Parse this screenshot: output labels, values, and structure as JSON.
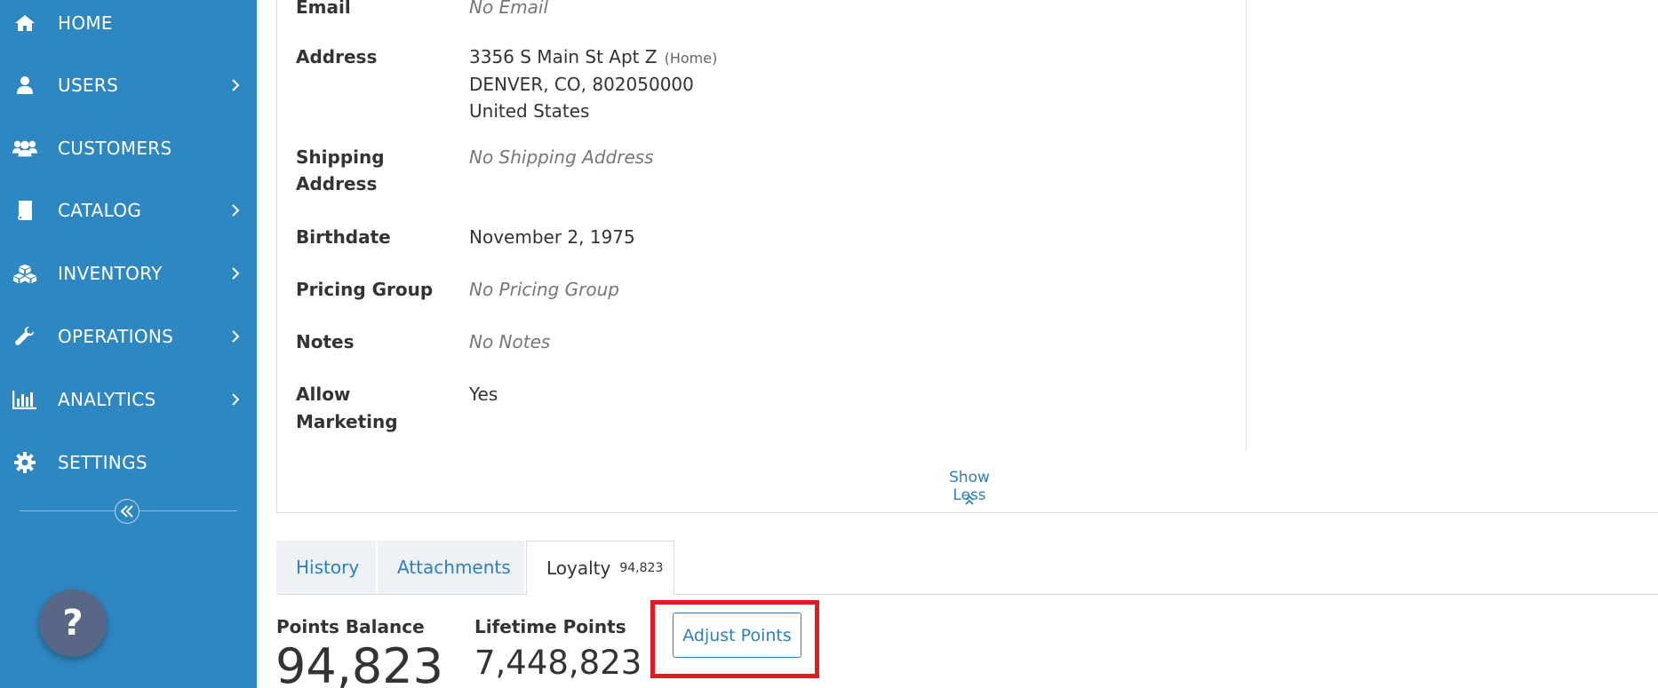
{
  "sidebar": {
    "items": [
      {
        "label": "HOME",
        "icon": "home-icon",
        "has_submenu": false
      },
      {
        "label": "USERS",
        "icon": "user-icon",
        "has_submenu": true
      },
      {
        "label": "CUSTOMERS",
        "icon": "users-icon",
        "has_submenu": false
      },
      {
        "label": "CATALOG",
        "icon": "book-icon",
        "has_submenu": true
      },
      {
        "label": "INVENTORY",
        "icon": "boxes-icon",
        "has_submenu": true
      },
      {
        "label": "OPERATIONS",
        "icon": "wrench-icon",
        "has_submenu": true
      },
      {
        "label": "ANALYTICS",
        "icon": "bar-chart-icon",
        "has_submenu": true
      },
      {
        "label": "SETTINGS",
        "icon": "gear-icon",
        "has_submenu": false
      }
    ],
    "collapse_icon": "double-chevron-left-icon",
    "help_label": "?"
  },
  "details": {
    "email": {
      "label": "Email",
      "value": "No Email"
    },
    "address": {
      "label": "Address",
      "line1": "3356 S Main St Apt Z",
      "type": "(Home)",
      "line2": "DENVER, CO, 802050000",
      "line3": "United States"
    },
    "shipping": {
      "label_line1": "Shipping",
      "label_line2": "Address",
      "value": "No Shipping Address"
    },
    "birthdate": {
      "label": "Birthdate",
      "value": "November 2, 1975"
    },
    "pricing_group": {
      "label": "Pricing Group",
      "value": "No Pricing Group"
    },
    "notes": {
      "label": "Notes",
      "value": "No Notes"
    },
    "marketing": {
      "label_line1": "Allow",
      "label_line2": "Marketing",
      "value": "Yes"
    },
    "show_less": "Show Less"
  },
  "tabs": [
    {
      "label": "History",
      "active": false
    },
    {
      "label": "Attachments",
      "active": false
    },
    {
      "label": "Loyalty",
      "badge": "94,823",
      "active": true
    }
  ],
  "loyalty": {
    "points_balance_label": "Points Balance",
    "points_balance": "94,823",
    "lifetime_points_label": "Lifetime Points",
    "lifetime_points": "7,448,823",
    "adjust_button": "Adjust Points"
  },
  "colors": {
    "sidebar_bg": "#2f87c2",
    "link": "#2f7fbf",
    "highlight": "#e01b24",
    "help_button": "#596787"
  }
}
